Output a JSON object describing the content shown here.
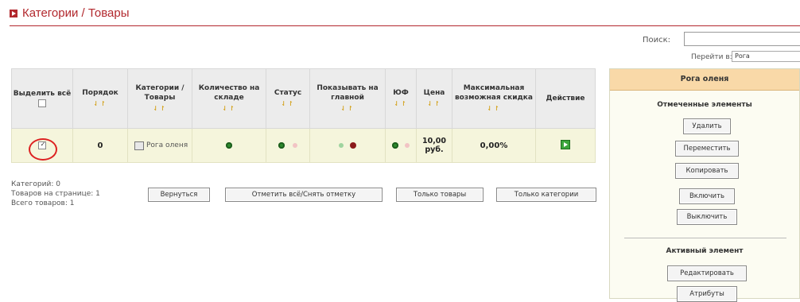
{
  "header": {
    "title": "Категории / Товары"
  },
  "search": {
    "label": "Поиск:",
    "value": "",
    "goto_label": "Перейти в:",
    "goto_value": "Рога"
  },
  "table": {
    "headers": [
      "Выделить всё",
      "Порядок",
      "Категории / Товары",
      "Количество на складе",
      "Статус",
      "Показывать на главной",
      "ЮФ",
      "Цена",
      "Максимальная возможная скидка",
      "Действие"
    ],
    "row": {
      "order": "0",
      "name": "Рога оленя",
      "price": "10,00 руб.",
      "discount": "0,00%"
    }
  },
  "info": {
    "categories": "Категорий: 0",
    "products_on_page": "Товаров на странице: 1",
    "total_products": "Всего товаров: 1"
  },
  "buttons": {
    "back": "Вернуться",
    "toggle_all": "Отметить всё/Снять отметку",
    "only_products": "Только товары",
    "only_categories": "Только категории"
  },
  "panel": {
    "title": "Рога оленя",
    "marked_title": "Отмеченные элементы",
    "delete": "Удалить",
    "move": "Переместить",
    "copy": "Копировать",
    "enable": "Включить",
    "disable": "Выключить",
    "active_title": "Активный элемент",
    "edit": "Редактировать",
    "attributes": "Атрибуты"
  },
  "colors": {
    "accent": "#b2282d",
    "row_bg": "#f5f5dc",
    "panel_head": "#f9d9a8",
    "circle": "#dd2222"
  }
}
